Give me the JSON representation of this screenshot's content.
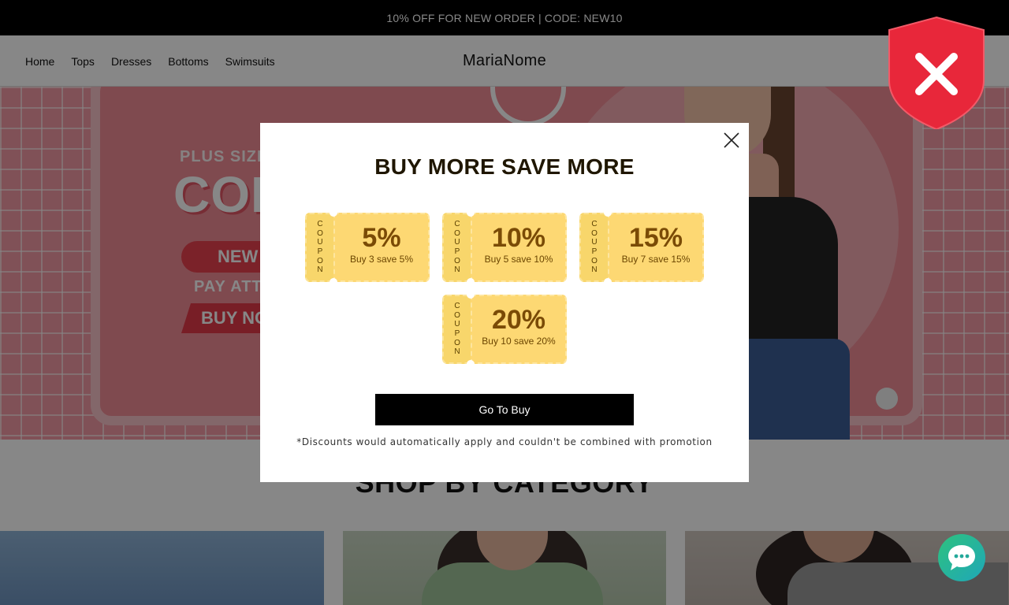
{
  "announcement": {
    "text": "10% OFF FOR NEW ORDER | CODE: NEW10"
  },
  "header": {
    "logo": "MariaNome",
    "nav": [
      "Home",
      "Tops",
      "Dresses",
      "Bottoms",
      "Swimsuits"
    ]
  },
  "hero": {
    "line1": "PLUS SIZE TO",
    "line2": "COLD",
    "pill": "NEW",
    "line3": "PAY ATTE",
    "ribbon": "BUY NO"
  },
  "section": {
    "title": "SHOP BY CATEGORY"
  },
  "popup": {
    "title": "BUY MORE SAVE MORE",
    "stub_label": "COUPON",
    "coupons": [
      {
        "percent": "5%",
        "desc": "Buy 3 save 5%"
      },
      {
        "percent": "10%",
        "desc": "Buy 5 save 10%"
      },
      {
        "percent": "15%",
        "desc": "Buy 7 save 15%"
      },
      {
        "percent": "20%",
        "desc": "Buy 10 save 20%"
      }
    ],
    "button": "Go To Buy",
    "note": "*Discounts would automatically apply and couldn't be combined with promotion"
  },
  "colors": {
    "coupon": "#fdd873",
    "button": "#000000",
    "shield": "#e8273a",
    "chat": "#2ec27e"
  },
  "icons": {
    "shield": "shield-x-icon",
    "close": "close-icon",
    "chat": "chat-bubble-icon"
  }
}
